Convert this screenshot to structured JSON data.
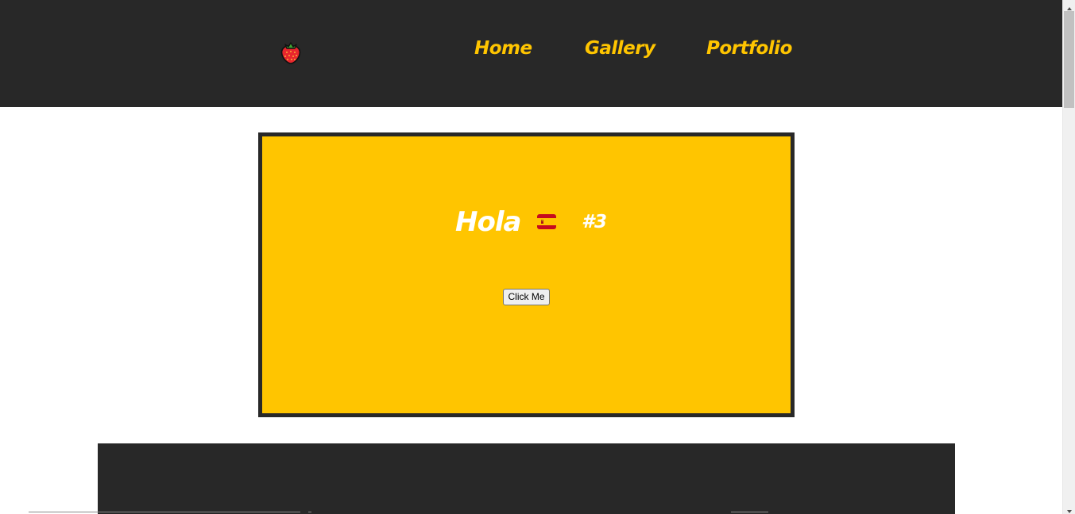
{
  "navbar": {
    "logo_icon": "strawberry-icon",
    "links": [
      {
        "label": "Home"
      },
      {
        "label": "Gallery"
      },
      {
        "label": "Portfolio"
      }
    ]
  },
  "card": {
    "greeting": "Hola",
    "flag_icon": "spain-flag-icon",
    "counter": "#3",
    "button_label": "Click Me"
  },
  "colors": {
    "dark": "#282828",
    "accent": "#ffc500",
    "text_light": "#ffffff"
  }
}
